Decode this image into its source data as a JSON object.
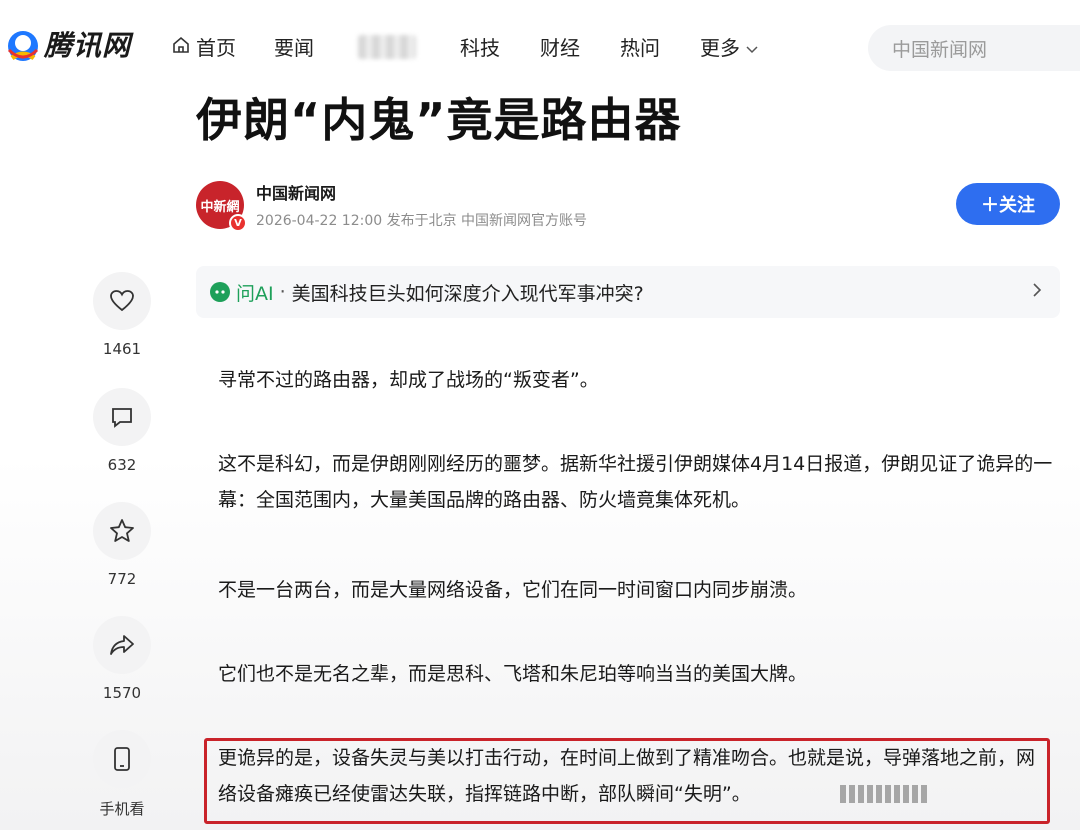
{
  "header": {
    "logo_text": "腾讯网",
    "nav": [
      {
        "label": "首页",
        "icon": "home-icon"
      },
      {
        "label": "要闻"
      },
      {
        "label": "科技"
      },
      {
        "label": "财经"
      },
      {
        "label": "热问"
      },
      {
        "label": "更多",
        "icon": "chevron-down-icon"
      }
    ],
    "search_placeholder": "中国新闻网"
  },
  "article": {
    "title": "伊朗“内鬼”竟是路由器",
    "author": {
      "name": "中国新闻网",
      "avatar_text": "中新網",
      "meta": "2026-04-22 12:00 发布于北京 中国新闻网官方账号"
    },
    "follow_label": "＋关注",
    "ai": {
      "label": "问AI",
      "separator": "·",
      "question": "美国科技巨头如何深度介入现代军事冲突?"
    },
    "paragraphs": [
      "寻常不过的路由器，却成了战场的“叛变者”。",
      "这不是科幻，而是伊朗刚刚经历的噩梦。据新华社援引伊朗媒体4月14日报道，伊朗见证了诡异的一幕：全国范围内，大量美国品牌的路由器、防火墙竟集体死机。",
      "不是一台两台，而是大量网络设备，它们在同一时间窗口内同步崩溃。",
      "它们也不是无名之辈，而是思科、飞塔和朱尼珀等响当当的美国大牌。",
      "更诡异的是，设备失灵与美以打击行动，在时间上做到了精准吻合。也就是说，导弹落地之前，网络设备瘫痪已经使雷达失联，指挥链路中断，部队瞬间“失明”。"
    ]
  },
  "actions": [
    {
      "icon": "heart-icon",
      "count": "1461"
    },
    {
      "icon": "comment-icon",
      "count": "632"
    },
    {
      "icon": "star-icon",
      "count": "772"
    },
    {
      "icon": "share-icon",
      "count": "1570"
    },
    {
      "icon": "phone-icon",
      "count": "手机看"
    }
  ],
  "colors": {
    "accent": "#2e6ef0",
    "ai_green": "#1ea05a",
    "highlight_red": "#c9232a"
  }
}
